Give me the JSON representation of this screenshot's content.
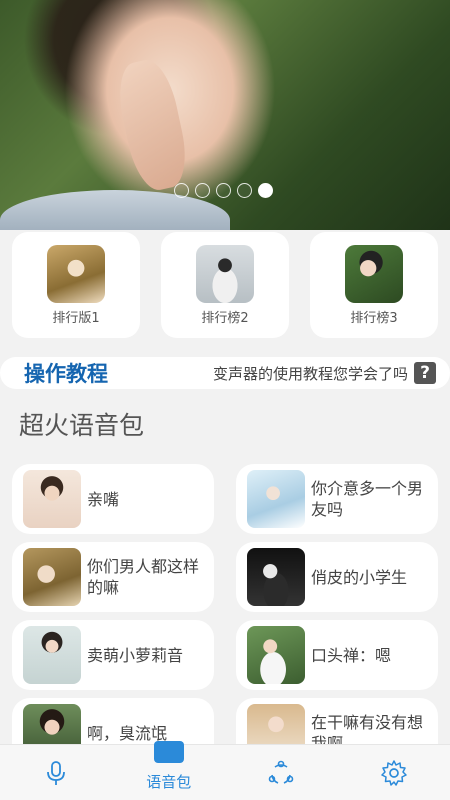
{
  "banner": {
    "dots_count": 5,
    "active_dot": 5
  },
  "rankings": [
    {
      "label": "排行版1"
    },
    {
      "label": "排行榜2"
    },
    {
      "label": "排行榜3"
    }
  ],
  "tutorial": {
    "title": "操作教程",
    "description": "变声器的使用教程您学会了吗",
    "help_icon": "?"
  },
  "section": {
    "title": "超火语音包"
  },
  "voice_packs": [
    {
      "name": "亲嘴"
    },
    {
      "name": "你介意多一个男友吗"
    },
    {
      "name": "你们男人都这样的嘛"
    },
    {
      "name": "俏皮的小学生"
    },
    {
      "name": "卖萌小萝莉音"
    },
    {
      "name": "口头禅：嗯"
    },
    {
      "name": "啊，臭流氓"
    },
    {
      "name": "在干嘛有没有想我啊"
    }
  ],
  "bottom_nav": {
    "items": [
      {
        "icon": "microphone-icon",
        "label": ""
      },
      {
        "icon": "voice-pack-icon",
        "label": "语音包"
      },
      {
        "icon": "share-icon",
        "label": ""
      },
      {
        "icon": "gear-icon",
        "label": ""
      }
    ],
    "active_color": "#2b8ad9"
  }
}
